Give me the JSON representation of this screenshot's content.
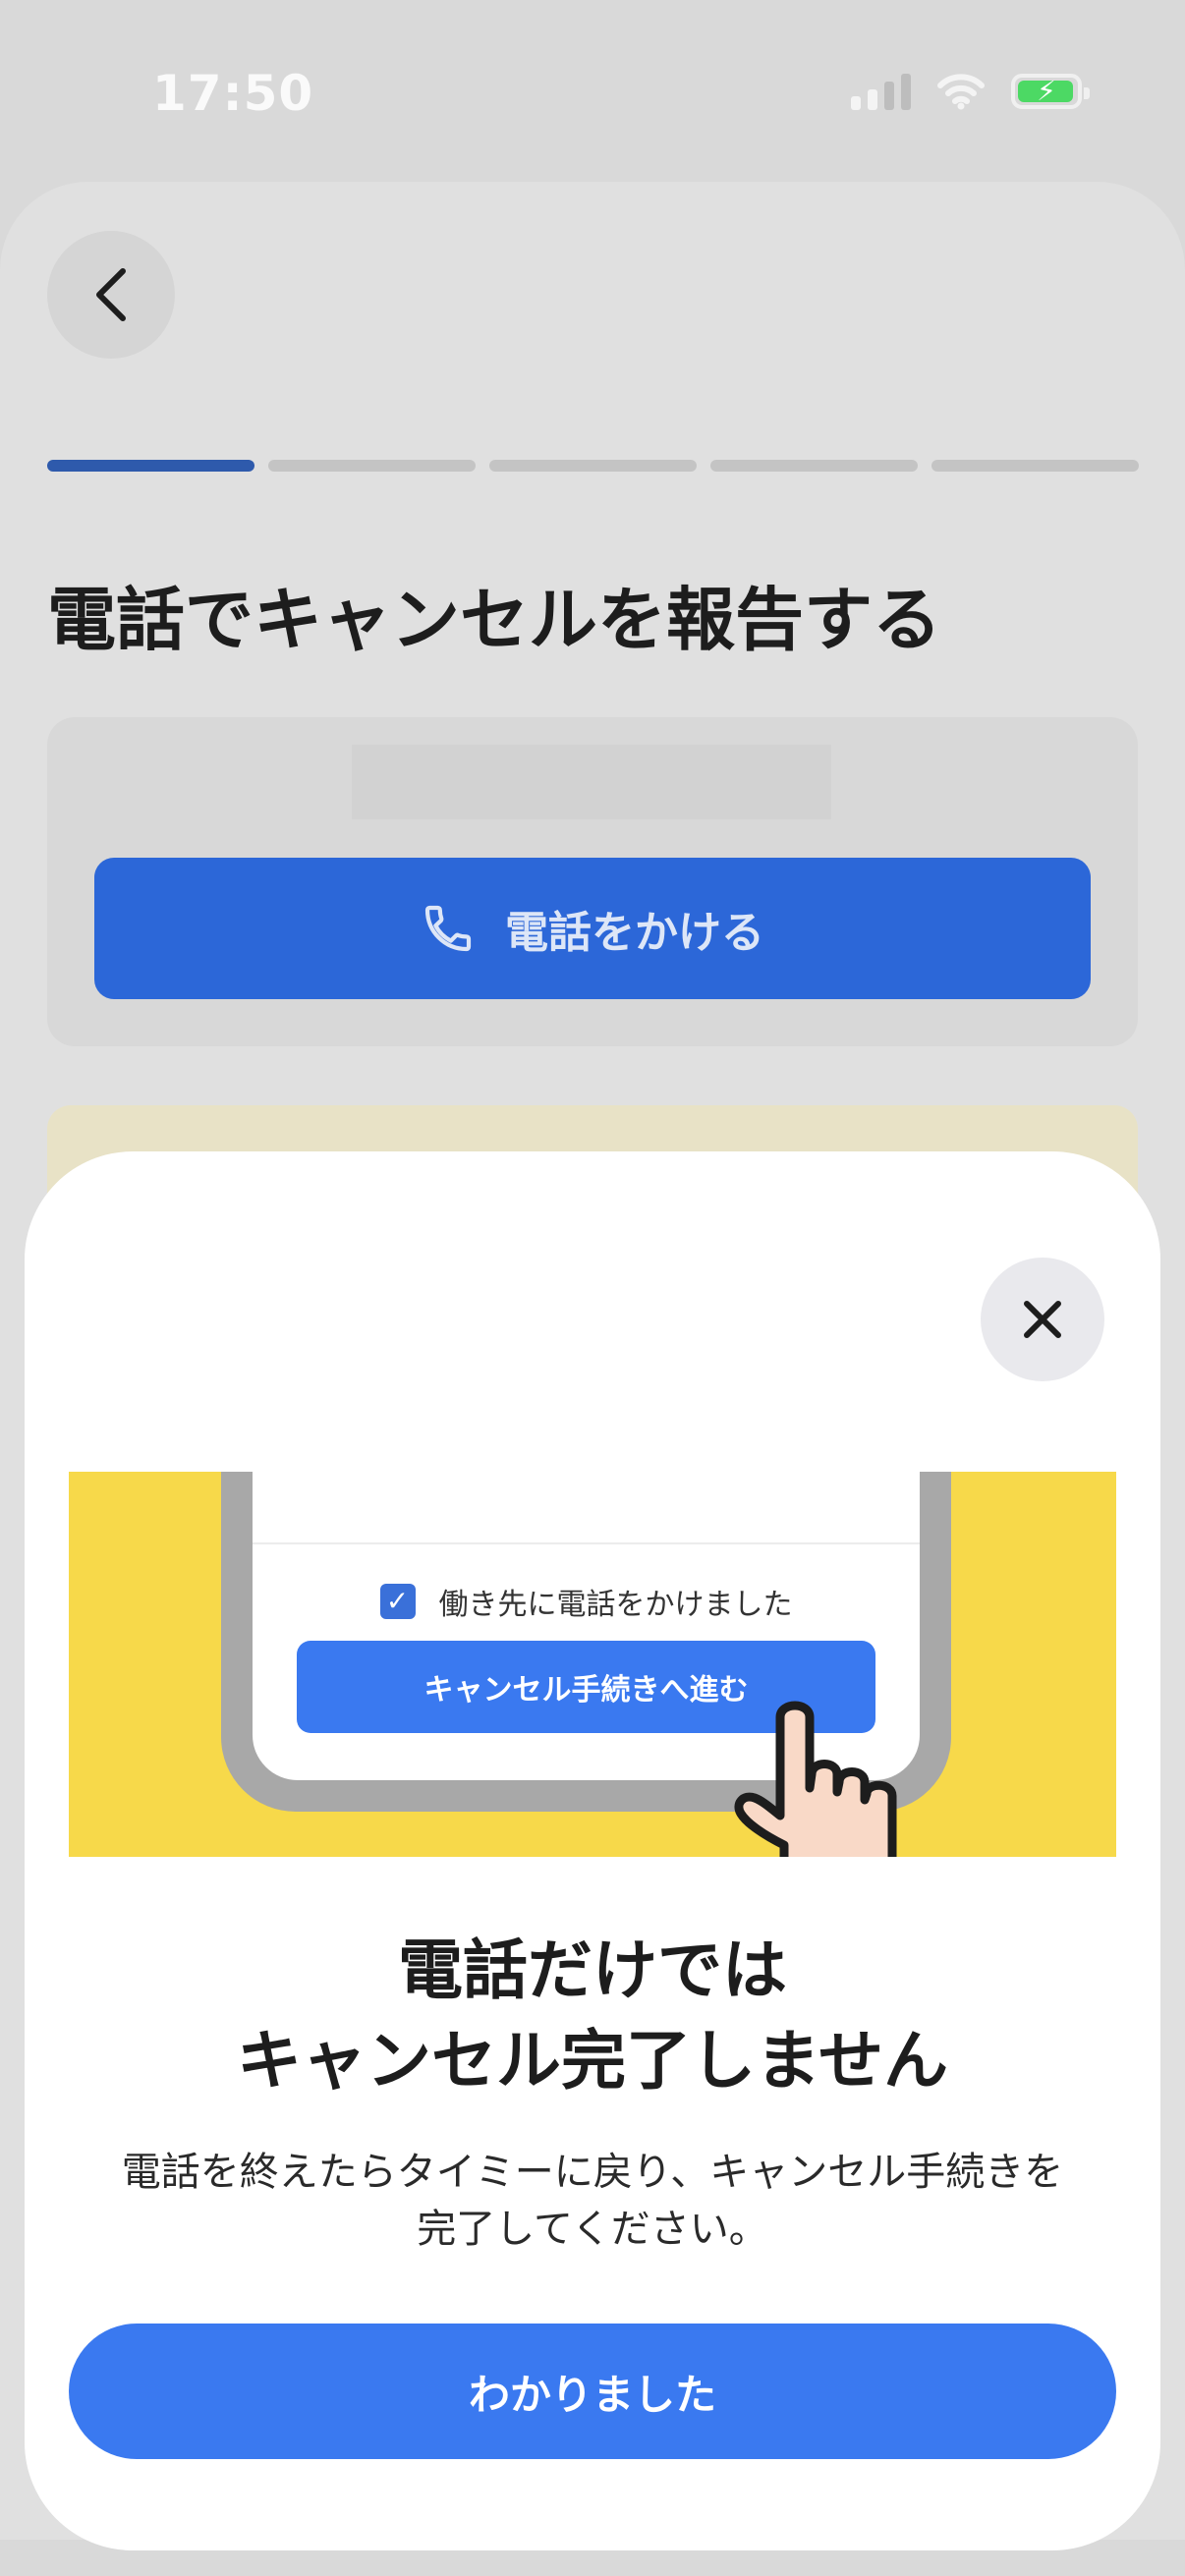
{
  "status_bar": {
    "time": "17:50",
    "icons": [
      "signal-icon",
      "wifi-icon",
      "battery-charging-icon"
    ]
  },
  "page": {
    "title": "電話でキャンセルを報告する",
    "progress": {
      "total_steps": 5,
      "current_step": 1
    },
    "call_button_label": "電話をかける",
    "icons": {
      "back": "chevron-left-icon",
      "phone": "phone-icon"
    }
  },
  "modal": {
    "illustration": {
      "checkbox_label": "働き先に電話をかけました",
      "button_label": "キャンセル手続きへ進む",
      "checkbox_checked": true
    },
    "title_line1": "電話だけでは",
    "title_line2": "キャンセル完了しません",
    "description_line1": "電話を終えたらタイミーに戻り、キャンセル手続きを",
    "description_line2": "完了してください。",
    "confirm_label": "わかりました",
    "close_icon": "close-icon"
  },
  "colors": {
    "primary": "#3a79f0",
    "illustration_bg": "#f7d94a",
    "progress_active": "#2e5aac"
  }
}
